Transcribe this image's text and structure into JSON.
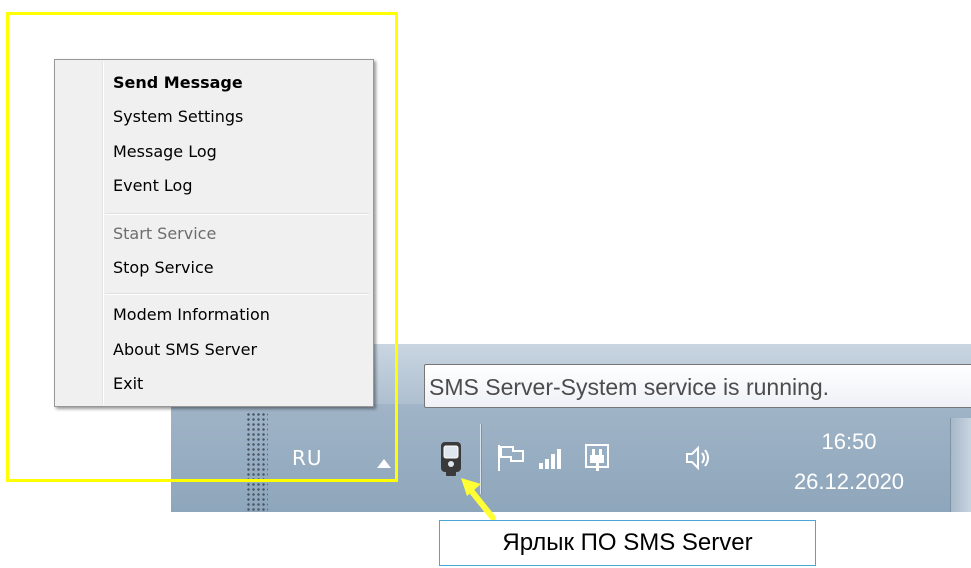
{
  "context_menu": {
    "items": [
      {
        "label": "Send Message",
        "style": "bold",
        "enabled": true
      },
      {
        "label": "System Settings",
        "enabled": true
      },
      {
        "label": "Message Log",
        "enabled": true
      },
      {
        "label": "Event Log",
        "enabled": true
      },
      {
        "label": "Start Service",
        "enabled": false
      },
      {
        "label": "Stop Service",
        "enabled": true
      },
      {
        "label": "Modem Information",
        "enabled": true
      },
      {
        "label": "About SMS Server",
        "enabled": true
      },
      {
        "label": "Exit",
        "enabled": true
      }
    ]
  },
  "taskbar": {
    "language": "RU",
    "time": "16:50",
    "date": "26.12.2020",
    "icons": [
      "sms-server-icon",
      "flag-icon",
      "signal-icon",
      "power-icon",
      "volume-icon"
    ]
  },
  "tooltip": {
    "text": "SMS Server-System service is running."
  },
  "annotation": {
    "caption": "Ярлык ПО SMS Server",
    "highlight_color": "#ffff00",
    "caption_border_color": "#4aa6d5"
  }
}
